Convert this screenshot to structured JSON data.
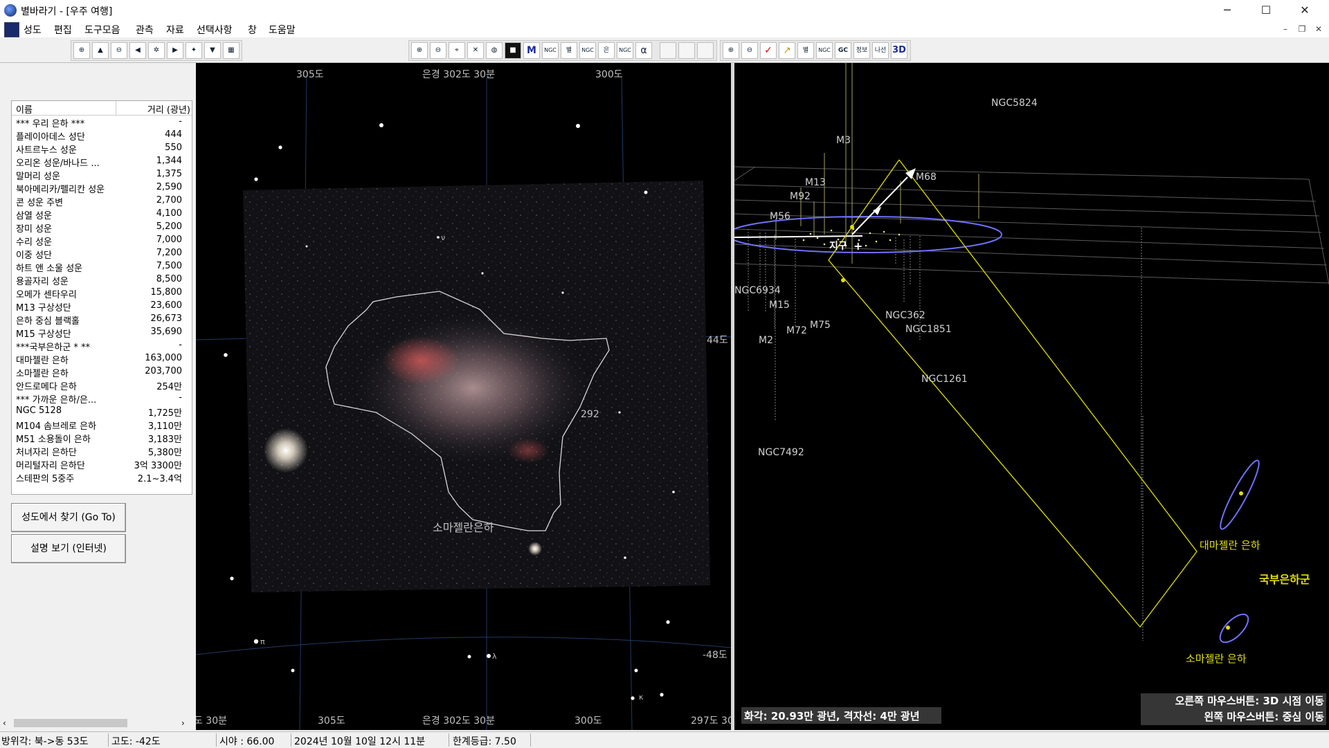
{
  "app": {
    "title": "별바라기 - [우주 여행]",
    "window_min": "─",
    "window_max": "☐",
    "window_close": "✕",
    "mdi_min": "–",
    "mdi_restore": "❐",
    "mdi_close": "✕"
  },
  "menu": [
    "성도",
    "편집",
    "도구모음",
    "관측",
    "자료",
    "선택사항",
    "창",
    "도움말"
  ],
  "toolbar": {
    "group1": [
      "⊕",
      "▲",
      "⊖",
      "◀",
      "✲",
      "▶",
      "✦",
      "▼",
      "▦"
    ],
    "group2": [
      "⊕",
      "⊖",
      "⌖",
      "✕",
      "◍",
      "■",
      "M",
      "NGC",
      "별",
      "NGC",
      "은",
      "NGC",
      "α",
      "",
      "",
      ""
    ],
    "group3": [
      "⊕",
      "⊖",
      "✓",
      "↗",
      "별",
      "NGC",
      "GC",
      "정보",
      "나선",
      "3D"
    ]
  },
  "object_list": {
    "col_name": "이름",
    "col_distance": "거리 (광년)",
    "rows": [
      {
        "name": "*** 우리 은하 ***",
        "distance": "-"
      },
      {
        "name": "플레이아데스 성단",
        "distance": "444"
      },
      {
        "name": "사트르누스 성운",
        "distance": "550"
      },
      {
        "name": "오리온 성운/바나드 ...",
        "distance": "1,344"
      },
      {
        "name": "말머리 성운",
        "distance": "1,375"
      },
      {
        "name": "북아메리카/펠리칸 성운",
        "distance": "2,590"
      },
      {
        "name": "콘 성운 주변",
        "distance": "2,700"
      },
      {
        "name": "삼열 성운",
        "distance": "4,100"
      },
      {
        "name": "장미 성운",
        "distance": "5,200"
      },
      {
        "name": "수리 성운",
        "distance": "7,000"
      },
      {
        "name": "이중 성단",
        "distance": "7,200"
      },
      {
        "name": "하트 앤 소울 성운",
        "distance": "7,500"
      },
      {
        "name": "용골자리 성운",
        "distance": "8,500"
      },
      {
        "name": "오메가 센타우리",
        "distance": "15,800"
      },
      {
        "name": "M13 구상성단",
        "distance": "23,600"
      },
      {
        "name": "은하 중심 블랙홀",
        "distance": "26,673"
      },
      {
        "name": "M15 구상성단",
        "distance": "35,690"
      },
      {
        "name": "***국부은하군 * **",
        "distance": "-"
      },
      {
        "name": "대마젤란 은하",
        "distance": "163,000"
      },
      {
        "name": "소마젤란 은하",
        "distance": "203,700"
      },
      {
        "name": "안드로메다 은하",
        "distance": "254만"
      },
      {
        "name": "*** 가까운 은하/은...",
        "distance": "-"
      },
      {
        "name": "NGC 5128",
        "distance": "1,725만"
      },
      {
        "name": "M104 솜브레로 은하",
        "distance": "3,110만"
      },
      {
        "name": "M51 소용돌이 은하",
        "distance": "3,183만"
      },
      {
        "name": "처녀자리 은하단",
        "distance": "5,380만"
      },
      {
        "name": "머리털자리 은하단",
        "distance": "3억 3300만"
      },
      {
        "name": "스테판의 5중주",
        "distance": "2.1~3.4억"
      }
    ]
  },
  "buttons": {
    "goto": "성도에서 찾기 (Go To)",
    "info": "설명 보기 (인터넷)"
  },
  "sky": {
    "top_ra_labels": [
      "305도",
      "은경 302도 30분",
      "300도"
    ],
    "bottom_ra_labels": [
      "도 30분",
      "305도",
      "은경 302도 30분",
      "300도",
      "297도 30"
    ],
    "dec_labels": [
      "44도",
      "-48도"
    ],
    "galaxy_label": "소마젤란은하",
    "ngc_label": "292",
    "star_labels": [
      "π",
      "λ",
      "κ",
      "ν"
    ]
  },
  "view3d": {
    "labels": [
      "NGC5824",
      "M3",
      "M68",
      "M13",
      "M92",
      "M56",
      "NGC6934",
      "M15",
      "M72",
      "M75",
      "M2",
      "NGC362",
      "NGC1851",
      "NGC1261",
      "NGC7492"
    ],
    "earth_label": "지구",
    "lmc_label": "대마젤란 은하",
    "smc_label": "소마젤란 은하",
    "group_label": "국부은하군",
    "fov_text": "화각: 20.93만 광년, 격자선: 4만 광년",
    "hint_right": "오른쪽 마우스버튼: 3D 시점 이동",
    "hint_left": "왼쪽 마우스버튼: 중심 이동"
  },
  "status": {
    "azimuth": "방위각: 북->동  53도",
    "altitude": "고도:  -42도",
    "fov": "시야 : 66.00",
    "datetime": "2024년 10월 10일 12시 11분",
    "limit_mag": "한계등급:  7.50"
  },
  "colors": {
    "grid_3d": "#5a5a5a",
    "yellow": "#e0e000",
    "ellipse_blue": "#7070ff"
  }
}
